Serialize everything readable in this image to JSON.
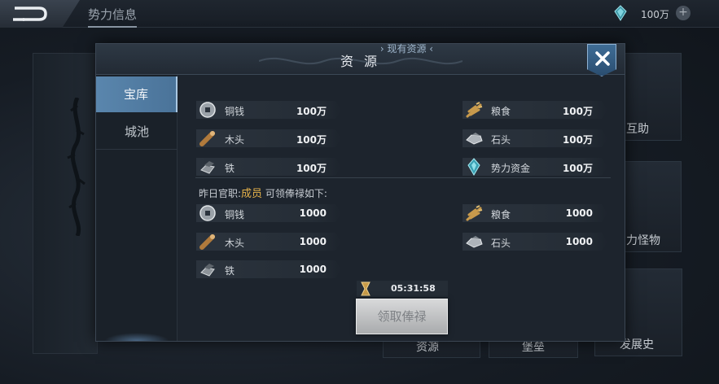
{
  "topbar": {
    "title": "势力信息",
    "currency_amount": "100万",
    "add_symbol": "+"
  },
  "background_cards": [
    {
      "label": "互助"
    },
    {
      "label": "力怪物"
    },
    {
      "label": "发展史"
    },
    {
      "label": "资源"
    },
    {
      "label": "堡垒"
    }
  ],
  "modal": {
    "title": "资 源",
    "close_glyph": "✕",
    "tabs": [
      {
        "label": "宝库",
        "active": true
      },
      {
        "label": "城池",
        "active": false
      }
    ],
    "current_section_title": "› 现有资源 ‹",
    "current_resources": [
      {
        "icon": "copper-coin-icon",
        "name": "铜钱",
        "value": "100万"
      },
      {
        "icon": "grain-icon",
        "name": "粮食",
        "value": "100万"
      },
      {
        "icon": "wood-icon",
        "name": "木头",
        "value": "100万"
      },
      {
        "icon": "stone-icon",
        "name": "石头",
        "value": "100万"
      },
      {
        "icon": "iron-icon",
        "name": "铁",
        "value": "100万"
      },
      {
        "icon": "faction-funds-icon",
        "name": "势力资金",
        "value": "100万"
      }
    ],
    "salary_caption_prefix": "昨日官职:",
    "salary_rank": "成员",
    "salary_caption_suffix": " 可领俸禄如下:",
    "salary_resources": [
      {
        "icon": "copper-coin-icon",
        "name": "铜钱",
        "value": "1000"
      },
      {
        "icon": "grain-icon",
        "name": "粮食",
        "value": "1000"
      },
      {
        "icon": "wood-icon",
        "name": "木头",
        "value": "1000"
      },
      {
        "icon": "stone-icon",
        "name": "石头",
        "value": "1000"
      },
      {
        "icon": "iron-icon",
        "name": "铁",
        "value": "1000"
      }
    ],
    "timer": "05:31:58",
    "claim_button_label": "领取俸禄"
  },
  "colors": {
    "accent_blue": "#4a7399",
    "rank_gold": "#e6b24a",
    "button_disabled": "#a9abad"
  }
}
